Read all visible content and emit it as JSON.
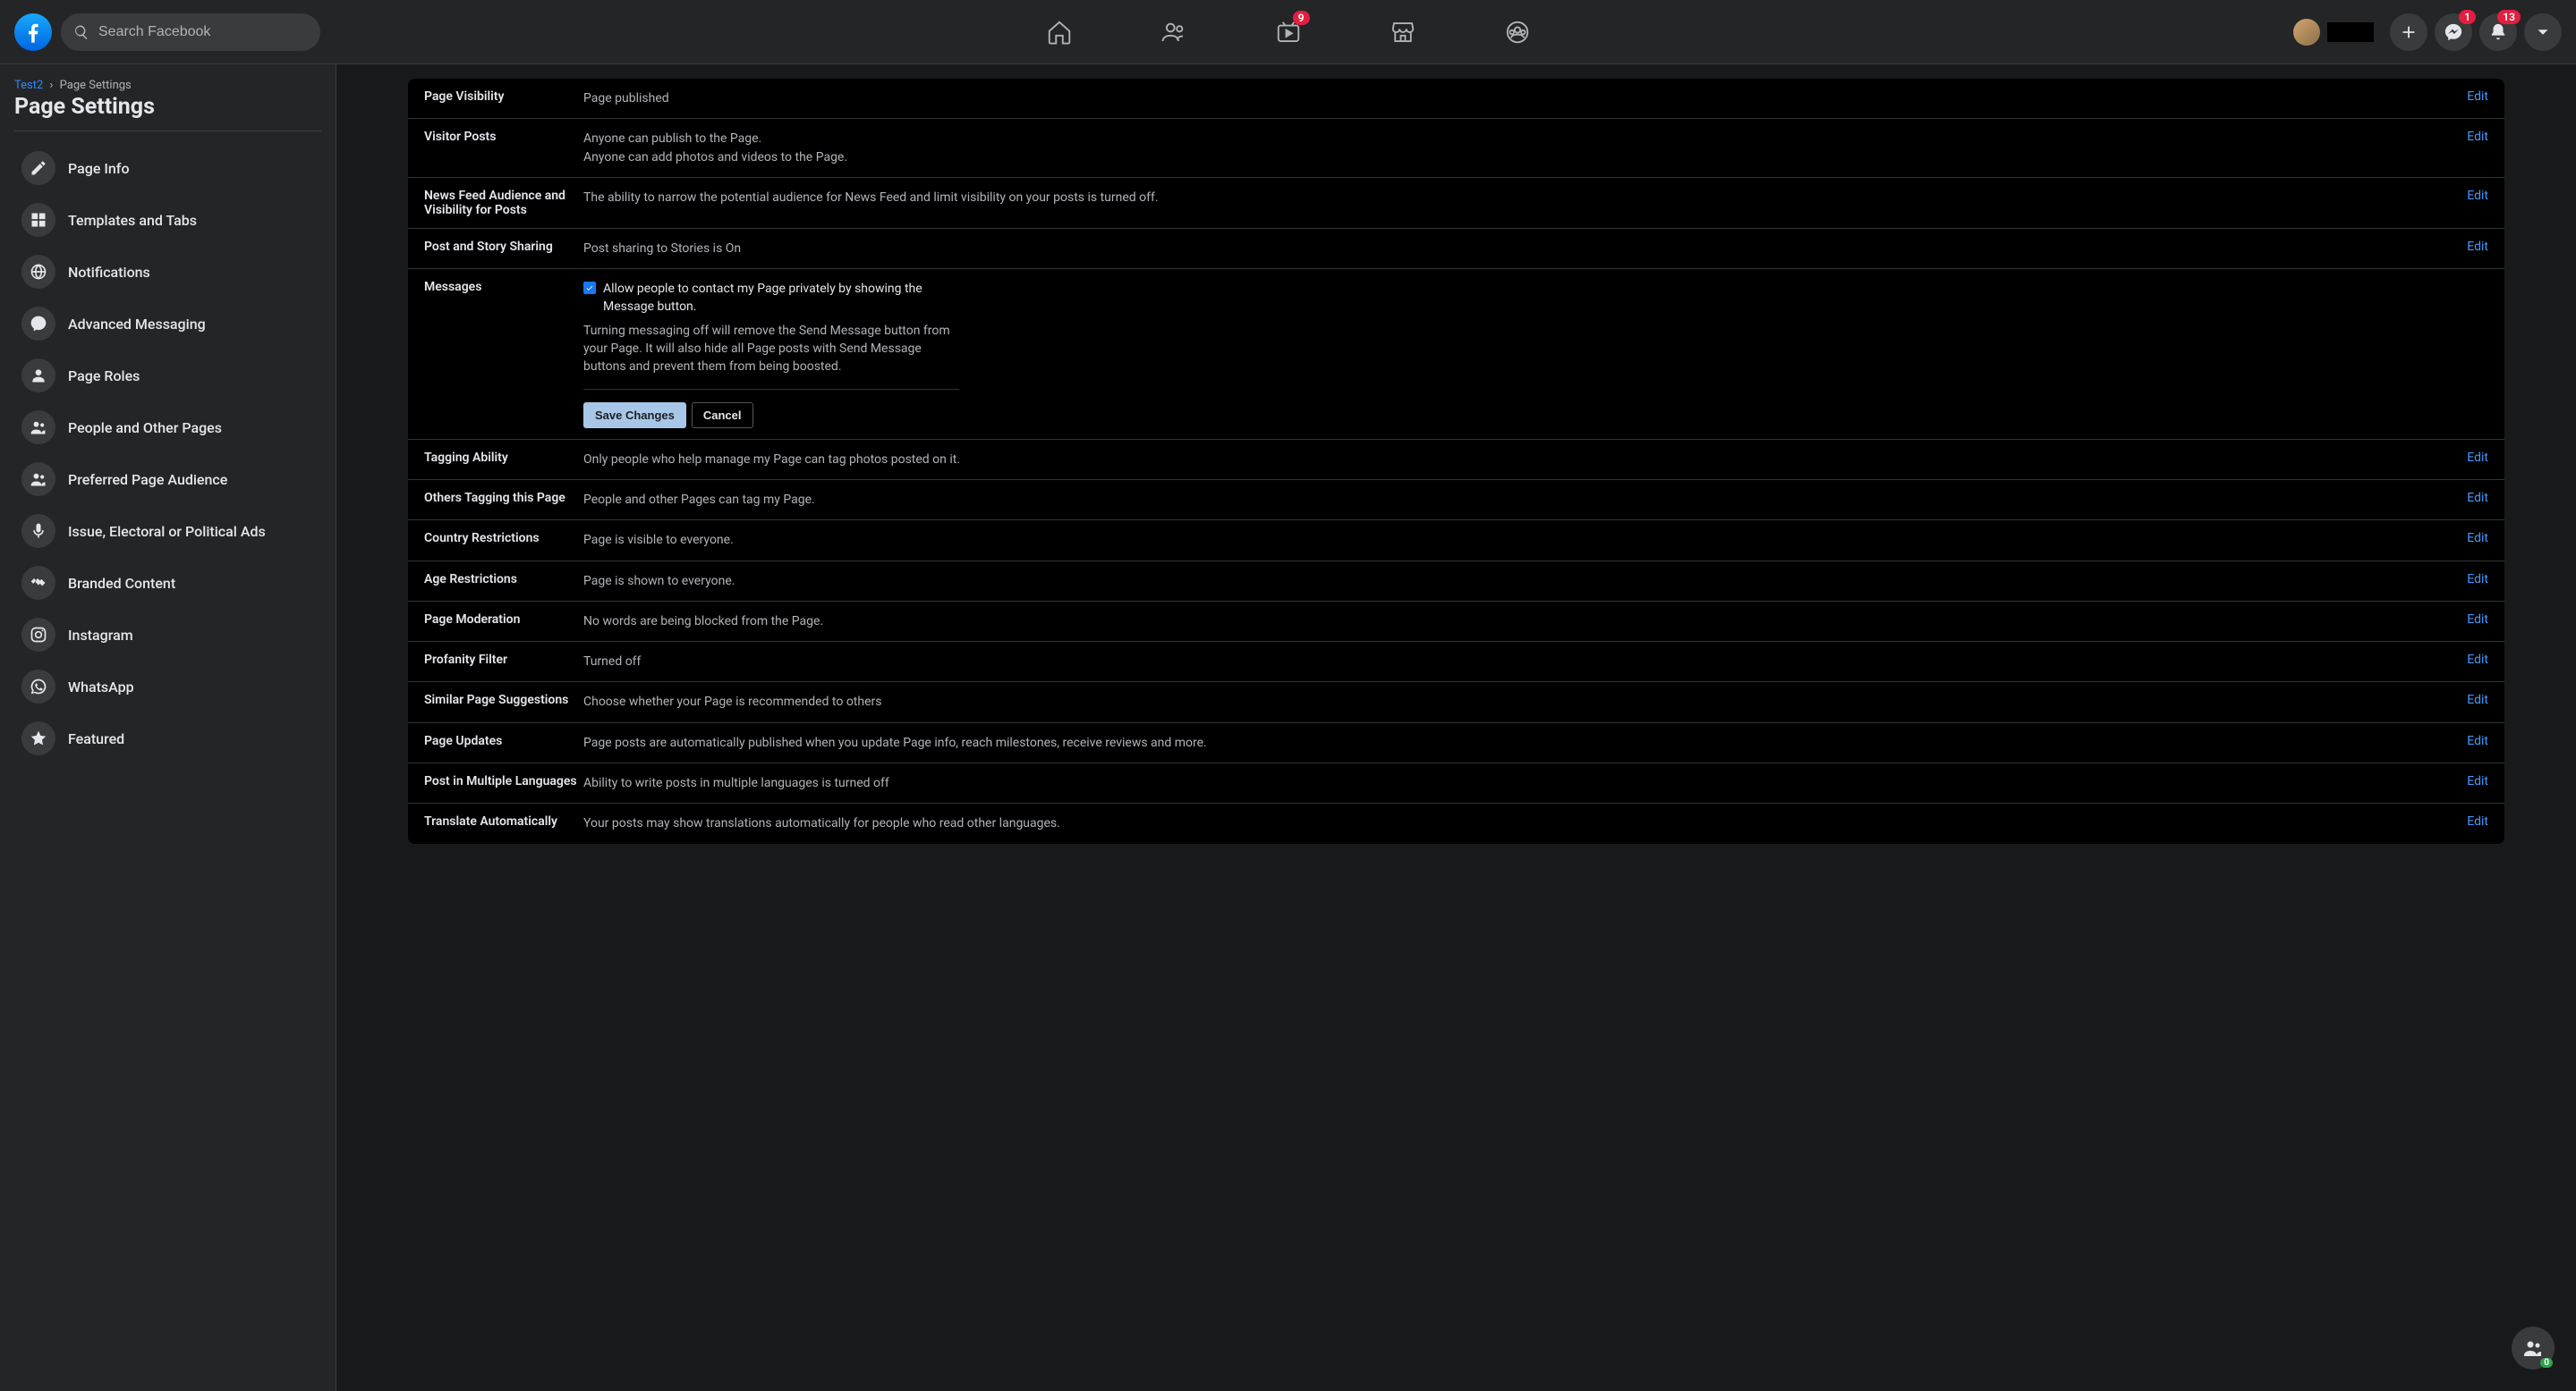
{
  "header": {
    "search_placeholder": "Search Facebook",
    "watch_badge": "9",
    "messenger_badge": "1",
    "notifications_badge": "13"
  },
  "breadcrumb": {
    "root": "Test2",
    "current": "Page Settings"
  },
  "page_title": "Page Settings",
  "sidebar": {
    "items": [
      {
        "label": "Page Info",
        "icon": "pencil"
      },
      {
        "label": "Templates and Tabs",
        "icon": "grid"
      },
      {
        "label": "Notifications",
        "icon": "globe"
      },
      {
        "label": "Advanced Messaging",
        "icon": "messenger"
      },
      {
        "label": "Page Roles",
        "icon": "person"
      },
      {
        "label": "People and Other Pages",
        "icon": "people"
      },
      {
        "label": "Preferred Page Audience",
        "icon": "people"
      },
      {
        "label": "Issue, Electoral or Political Ads",
        "icon": "mic"
      },
      {
        "label": "Branded Content",
        "icon": "handshake"
      },
      {
        "label": "Instagram",
        "icon": "instagram"
      },
      {
        "label": "WhatsApp",
        "icon": "whatsapp"
      },
      {
        "label": "Featured",
        "icon": "star"
      }
    ]
  },
  "settings": [
    {
      "label": "Page Visibility",
      "desc": "Page published",
      "edit": "Edit"
    },
    {
      "label": "Visitor Posts",
      "desc": "Anyone can publish to the Page.\nAnyone can add photos and videos to the Page.",
      "edit": "Edit"
    },
    {
      "label": "News Feed Audience and Visibility for Posts",
      "desc": "The ability to narrow the potential audience for News Feed and limit visibility on your posts is turned off.",
      "edit": "Edit"
    },
    {
      "label": "Post and Story Sharing",
      "desc": "Post sharing to Stories is On",
      "edit": "Edit"
    }
  ],
  "messages": {
    "label": "Messages",
    "checkbox_label": "Allow people to contact my Page privately by showing the Message button.",
    "note": "Turning messaging off will remove the Send Message button from your Page. It will also hide all Page posts with Send Message buttons and prevent them from being boosted.",
    "save": "Save Changes",
    "cancel": "Cancel"
  },
  "settings2": [
    {
      "label": "Tagging Ability",
      "desc": "Only people who help manage my Page can tag photos posted on it.",
      "edit": "Edit"
    },
    {
      "label": "Others Tagging this Page",
      "desc": "People and other Pages can tag my Page.",
      "edit": "Edit"
    },
    {
      "label": "Country Restrictions",
      "desc": "Page is visible to everyone.",
      "edit": "Edit"
    },
    {
      "label": "Age Restrictions",
      "desc": "Page is shown to everyone.",
      "edit": "Edit"
    },
    {
      "label": "Page Moderation",
      "desc": "No words are being blocked from the Page.",
      "edit": "Edit"
    },
    {
      "label": "Profanity Filter",
      "desc": "Turned off",
      "edit": "Edit"
    },
    {
      "label": "Similar Page Suggestions",
      "desc": "Choose whether your Page is recommended to others",
      "edit": "Edit"
    },
    {
      "label": "Page Updates",
      "desc": "Page posts are automatically published when you update Page info, reach milestones, receive reviews and more.",
      "edit": "Edit"
    },
    {
      "label": "Post in Multiple Languages",
      "desc": "Ability to write posts in multiple languages is turned off",
      "edit": "Edit"
    },
    {
      "label": "Translate Automatically",
      "desc": "Your posts may show translations automatically for people who read other languages.",
      "edit": "Edit"
    }
  ],
  "float_badge": "0"
}
